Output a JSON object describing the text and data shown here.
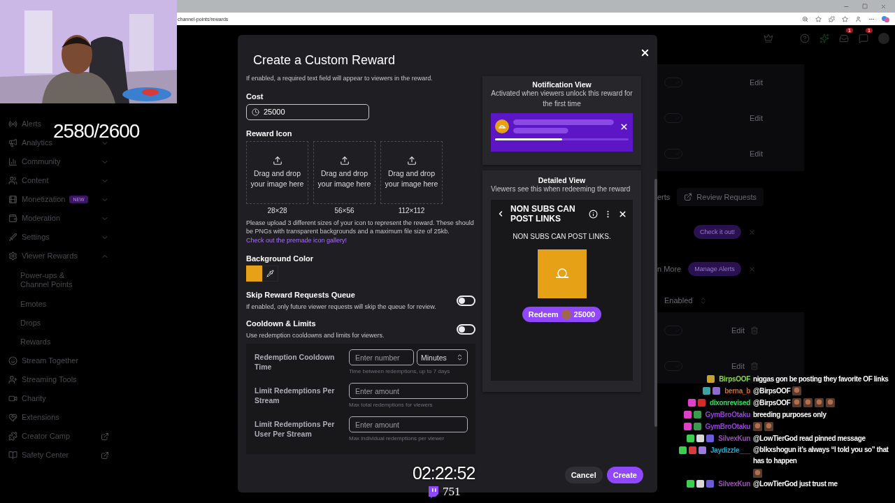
{
  "browser": {
    "url": "channel-points/rewards"
  },
  "stream_overlay": {
    "goal": "2580/2600",
    "uptime": "02:22:52",
    "viewers": "751"
  },
  "sidebar": {
    "items": [
      {
        "label": "Alerts",
        "kind": "link"
      },
      {
        "label": "Analytics",
        "kind": "group",
        "expanded": false
      },
      {
        "label": "Community",
        "kind": "group",
        "expanded": false
      },
      {
        "label": "Content",
        "kind": "group",
        "expanded": false
      },
      {
        "label": "Monetization",
        "kind": "group",
        "expanded": false,
        "badge": "NEW"
      },
      {
        "label": "Moderation",
        "kind": "group",
        "expanded": false
      },
      {
        "label": "Settings",
        "kind": "group",
        "expanded": false
      },
      {
        "label": "Viewer Rewards",
        "kind": "group",
        "expanded": true,
        "children": [
          {
            "label": "Power-ups & Channel Points"
          },
          {
            "label": "Emotes"
          },
          {
            "label": "Drops"
          },
          {
            "label": "Rewards"
          }
        ]
      },
      {
        "label": "Stream Together",
        "kind": "link"
      },
      {
        "label": "Streaming Tools",
        "kind": "link"
      },
      {
        "label": "Charity",
        "kind": "link"
      },
      {
        "label": "Extensions",
        "kind": "link"
      },
      {
        "label": "Creator Camp",
        "kind": "external"
      },
      {
        "label": "Safety Center",
        "kind": "external"
      }
    ]
  },
  "top_nav": {
    "inbox_badge": "1",
    "whispers_badge": "1"
  },
  "background": {
    "reward_rows": [
      {
        "action": "Edit"
      },
      {
        "action": "Edit"
      },
      {
        "action": "Edit"
      }
    ],
    "alerts_partial": "erts",
    "review_requests": "Review Requests",
    "promo": "Check it out!",
    "more_partial": "n More",
    "manage_alerts": "Manage Alerts",
    "filter": "Enabled",
    "lower_rows": [
      {
        "action": "Edit"
      },
      {
        "action": "Edit"
      }
    ]
  },
  "modal": {
    "title": "Create a Custom Reward",
    "intro": "If enabled, a required text field will appear to viewers in the reward.",
    "cost": {
      "label": "Cost",
      "value": "25000"
    },
    "reward_icon": {
      "label": "Reward Icon",
      "slots": [
        {
          "prompt": "Drag and drop your image here",
          "size": "28×28"
        },
        {
          "prompt": "Drag and drop your image here",
          "size": "56×56"
        },
        {
          "prompt": "Drag and drop your image here",
          "size": "112×112"
        }
      ],
      "note": "Please upload 3 different sizes of your icon to represent the reward. These should be PNGs with transparent backgrounds and a maximum file size of 25kb.",
      "link": "Check out the premade icon gallery!"
    },
    "background_color": {
      "label": "Background Color",
      "color": "#e6a117"
    },
    "skip_queue": {
      "label": "Skip Reward Requests Queue",
      "description": "If enabled, only future viewer requests will skip the queue for review.",
      "on": false
    },
    "cooldown": {
      "label": "Cooldown & Limits",
      "description": "Use redemption cooldowns and limits for viewers.",
      "on": false,
      "rows": [
        {
          "label": "Redemption Cooldown Time",
          "placeholder": "Enter number",
          "unit": "Minutes",
          "hint": "Time between redemptions, up to 7 days"
        },
        {
          "label": "Limit Redemptions Per Stream",
          "placeholder": "Enter amount",
          "hint": "Max total redemptions for viewers"
        },
        {
          "label": "Limit Redemptions Per User Per Stream",
          "placeholder": "Enter amount",
          "hint": "Max individual redemptions per viewer"
        }
      ]
    },
    "preview": {
      "notification": {
        "title": "Notification View",
        "description": "Activated when viewers unlock this reward for the first time",
        "level": 0.5
      },
      "detailed": {
        "title": "Detailed View",
        "description": "Viewers see this when redeeming the reward",
        "reward_title": "NON SUBS CAN POST LINKS",
        "prompt": "NON SUBS CAN POST LINKS.",
        "redeem": "Redeem",
        "cost": "25000"
      }
    },
    "buttons": [
      {
        "label": "Cancel",
        "kind": "secondary"
      },
      {
        "label": "Create",
        "kind": "primary"
      }
    ]
  },
  "chat": {
    "messages": [
      {
        "badges": [
          {
            "color": "#c9a227"
          }
        ],
        "user": "BirpsOOF",
        "color": "#8fd14f",
        "parts": [
          {
            "kind": "text",
            "text": "niggas gon be posting they favorite OF links"
          }
        ]
      },
      {
        "badges": [
          {
            "color": "#3ba3a3"
          },
          {
            "color": "#8f6bd1"
          }
        ],
        "user": "berna_b",
        "color": "#d2691e",
        "parts": [
          {
            "kind": "text",
            "text": "@BirpsOOF"
          },
          {
            "kind": "emote"
          }
        ]
      },
      {
        "badges": [
          {
            "color": "#e040c8"
          },
          {
            "color": "#d42a2a"
          }
        ],
        "user": "dixonrevised",
        "color": "#27e05a",
        "parts": [
          {
            "kind": "text",
            "text": "@BirpsOOF"
          },
          {
            "kind": "emote"
          },
          {
            "kind": "emote"
          },
          {
            "kind": "emote"
          },
          {
            "kind": "emote"
          }
        ]
      },
      {
        "badges": [
          {
            "color": "#e040c8"
          },
          {
            "color": "#3c9a50"
          }
        ],
        "user": "GymBroOtaku",
        "color": "#9b3fe0",
        "parts": [
          {
            "kind": "text",
            "text": "breeding purposes only"
          }
        ]
      },
      {
        "badges": [
          {
            "color": "#e040c8"
          },
          {
            "color": "#3c9a50"
          }
        ],
        "user": "GymBroOtaku",
        "color": "#9b3fe0",
        "parts": [
          {
            "kind": "emote"
          },
          {
            "kind": "emote"
          }
        ]
      },
      {
        "badges": [
          {
            "color": "#3ccf4e"
          },
          {
            "color": "#d8d8d8"
          },
          {
            "color": "#6b5bd6"
          }
        ],
        "user": "SilvexKun",
        "color": "#9a4fb3",
        "parts": [
          {
            "kind": "text",
            "text": "@LowTierGod read pinned message"
          }
        ]
      },
      {
        "badges": [
          {
            "color": "#3ccf4e"
          },
          {
            "color": "#d93a3a"
          },
          {
            "color": "#9b7be0"
          }
        ],
        "user": "Jaydizzle___",
        "color": "#2aa3c8",
        "parts": [
          {
            "kind": "text",
            "text": "@blkxshogun it’s always “I told you so” that has to happen"
          },
          {
            "kind": "emote"
          }
        ]
      },
      {
        "badges": [
          {
            "color": "#3ccf4e"
          },
          {
            "color": "#d8d8d8"
          },
          {
            "color": "#6b5bd6"
          }
        ],
        "user": "SilvexKun",
        "color": "#9a4fb3",
        "parts": [
          {
            "kind": "text",
            "text": "@LowTierGod just trust me"
          }
        ]
      }
    ]
  }
}
